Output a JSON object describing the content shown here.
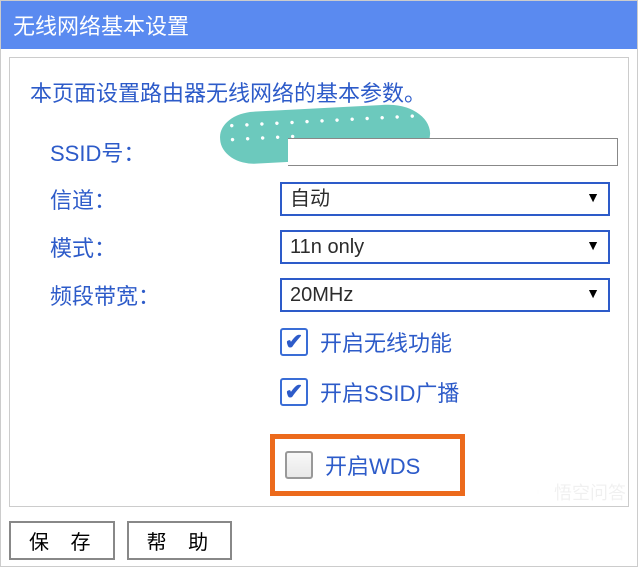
{
  "header": {
    "title": "无线网络基本设置"
  },
  "intro": "本页面设置路由器无线网络的基本参数。",
  "form": {
    "ssid_label": "SSID号：",
    "ssid_value": "",
    "channel_label": "信道：",
    "channel_value": "自动",
    "mode_label": "模式：",
    "mode_value": "11n only",
    "bandwidth_label": "频段带宽：",
    "bandwidth_value": "20MHz"
  },
  "checkboxes": {
    "wireless_enable": "开启无线功能",
    "ssid_broadcast": "开启SSID广播",
    "wds": "开启WDS"
  },
  "buttons": {
    "save": "保 存",
    "help": "帮 助"
  },
  "watermark": "悟空问答"
}
